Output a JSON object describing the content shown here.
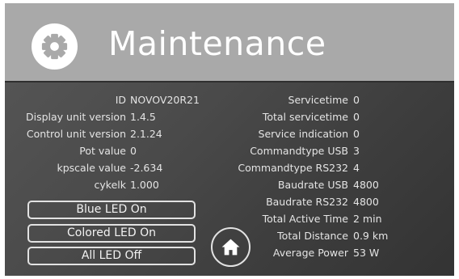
{
  "header": {
    "title": "Maintenance",
    "icon": "gear-icon"
  },
  "left_fields": [
    {
      "label": "ID",
      "value": "NOVOV20R21"
    },
    {
      "label": "Display unit version",
      "value": "1.4.5"
    },
    {
      "label": "Control unit version",
      "value": "2.1.24"
    },
    {
      "label": "Pot value",
      "value": "0"
    },
    {
      "label": "kpscale value",
      "value": "-2.634"
    },
    {
      "label": "cykelk",
      "value": "1.000"
    }
  ],
  "right_fields": [
    {
      "label": "Servicetime",
      "value": "0"
    },
    {
      "label": "Total servicetime",
      "value": "0"
    },
    {
      "label": "Service indication",
      "value": "0"
    },
    {
      "label": "Commandtype USB",
      "value": "3"
    },
    {
      "label": "Commandtype RS232",
      "value": "4"
    },
    {
      "label": "Baudrate USB",
      "value": "4800"
    },
    {
      "label": "Baudrate RS232",
      "value": "4800"
    },
    {
      "label": "Total Active Time",
      "value": "2 min"
    },
    {
      "label": "Total Distance",
      "value": "0.9 km"
    },
    {
      "label": "Average Power",
      "value": "53 W"
    }
  ],
  "buttons": {
    "blue_led": "Blue LED On",
    "colored_led": "Colored LED On",
    "all_off": "All LED Off",
    "home_icon": "home-icon"
  },
  "colors": {
    "header_bg": "#a9a9a9",
    "panel_bg": "#3a3a3a",
    "text": "#e4e4e4"
  }
}
